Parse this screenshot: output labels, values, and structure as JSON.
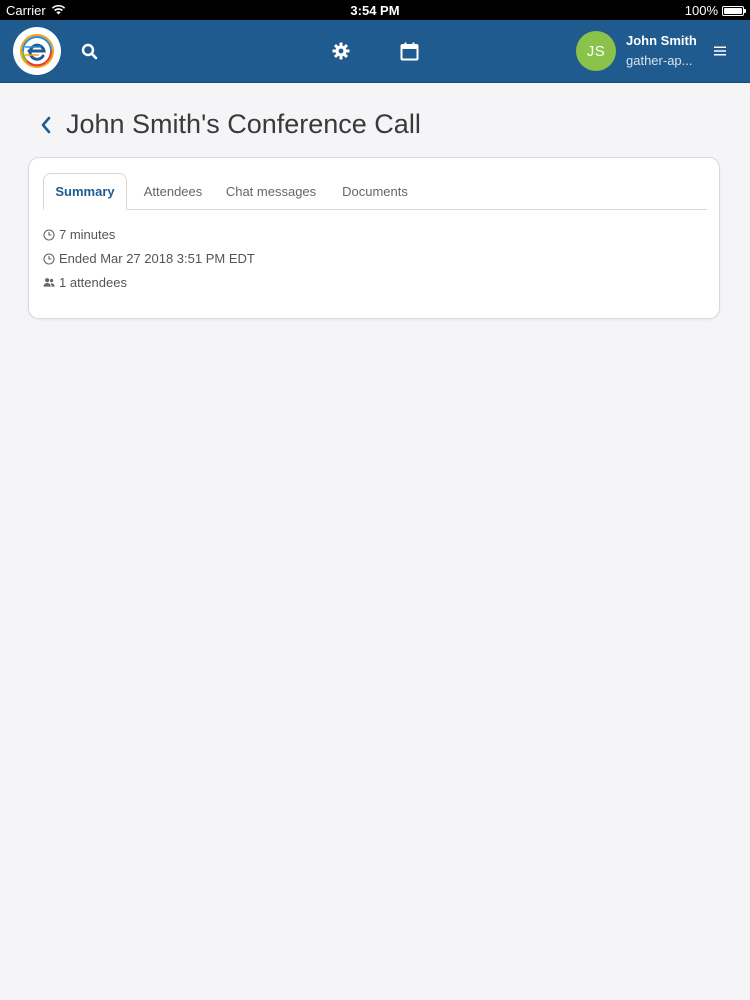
{
  "status_bar": {
    "carrier": "Carrier",
    "time": "3:54 PM",
    "battery": "100%"
  },
  "header": {
    "avatar_initials": "JS",
    "user_name": "John Smith",
    "user_org": "gather-ap...",
    "brand_color": "#1f5b8e",
    "avatar_color": "#8bc34a",
    "icons": [
      "logo-icon",
      "search-icon",
      "gear-icon",
      "calendar-icon",
      "menu-icon"
    ]
  },
  "page": {
    "title": "John Smith's Conference Call"
  },
  "tabs": [
    {
      "label": "Summary",
      "active": true
    },
    {
      "label": "Attendees",
      "active": false
    },
    {
      "label": "Chat messages",
      "active": false
    },
    {
      "label": "Documents",
      "active": false
    }
  ],
  "summary": {
    "duration": "7 minutes",
    "ended": "Ended Mar 27 2018 3:51 PM EDT",
    "attendees": "1 attendees"
  }
}
